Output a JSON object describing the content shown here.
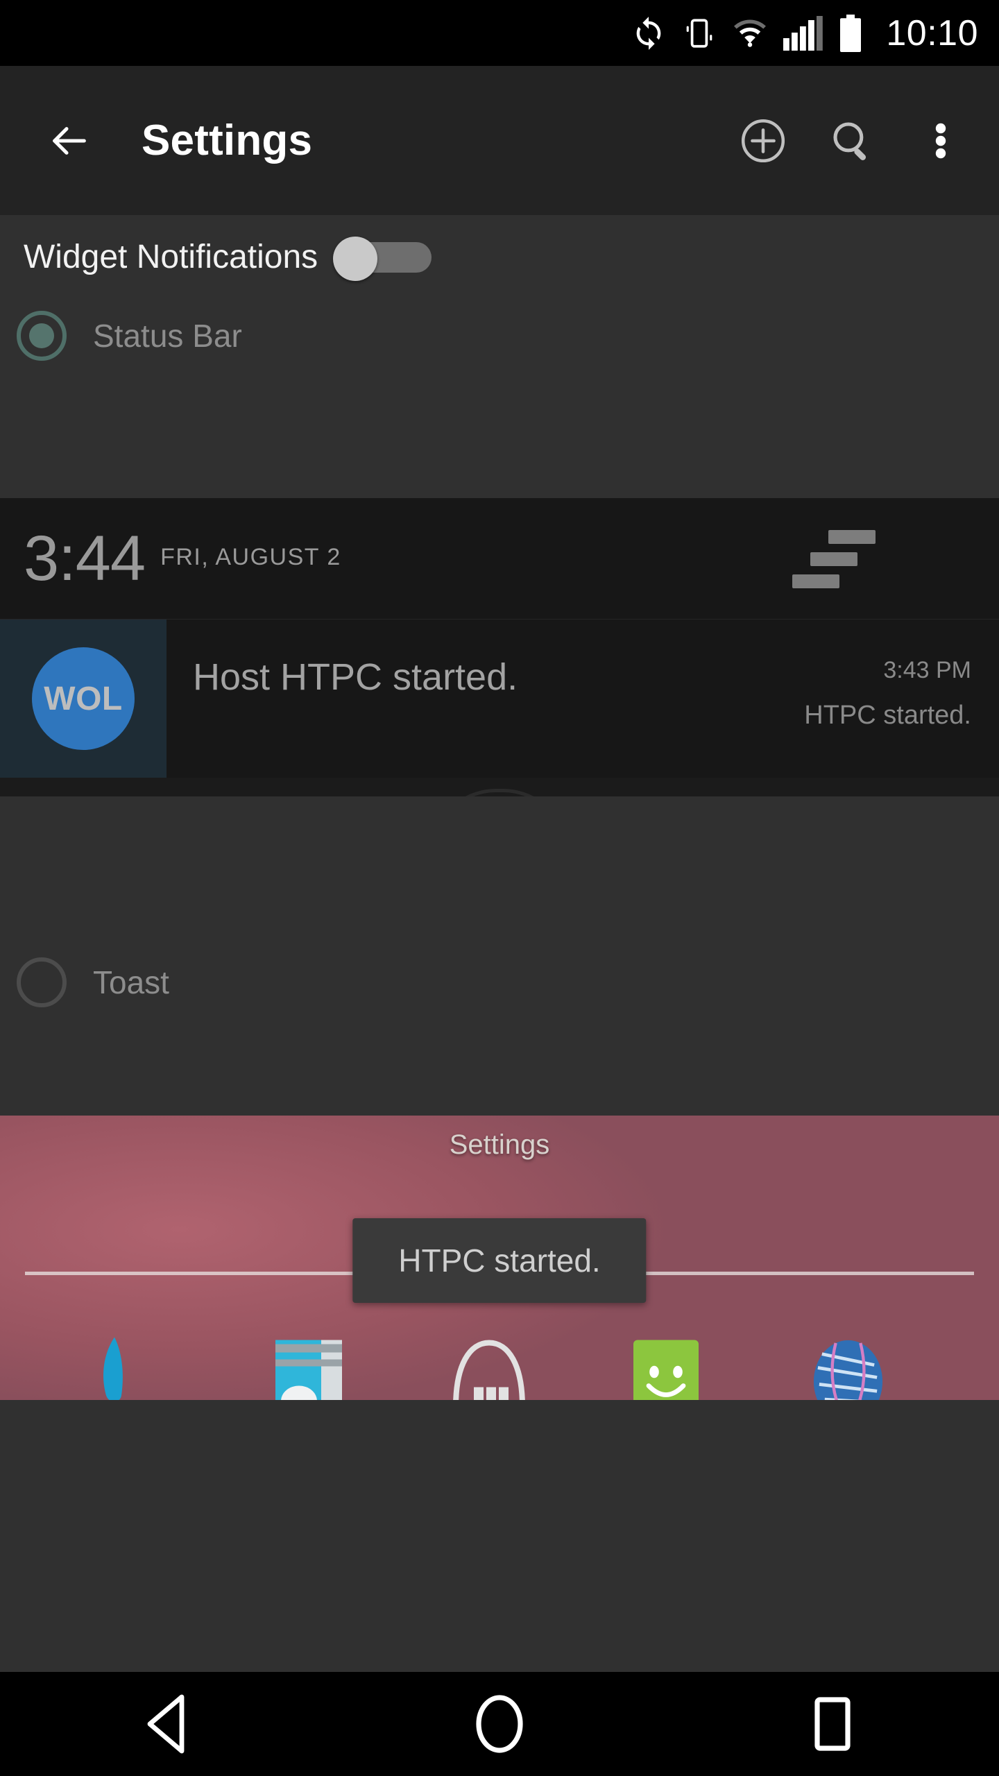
{
  "status_bar": {
    "time": "10:10",
    "icons": [
      "sync-icon",
      "vibrate-icon",
      "wifi-icon",
      "signal-icon",
      "battery-icon"
    ]
  },
  "action_bar": {
    "back_label": "back-arrow-icon",
    "title": "Settings",
    "actions": [
      "add-icon",
      "search-icon",
      "overflow-menu-icon"
    ]
  },
  "settings": {
    "widget_notifications": {
      "label": "Widget Notifications",
      "toggle_state": "off"
    },
    "options": [
      {
        "label": "Status Bar",
        "selected": true
      },
      {
        "label": "Toast",
        "selected": false
      }
    ]
  },
  "notification_preview": {
    "clock": "3:44",
    "date": "FRI, AUGUST 2",
    "quick_settings_icon": "quick-settings-icon",
    "notification": {
      "app_icon_text": "WOL",
      "title": "Host HTPC started.",
      "time": "3:43 PM",
      "subtitle": "HTPC started."
    }
  },
  "home_preview": {
    "page_label": "Settings",
    "toast_text": "HTPC started.",
    "dock_icons": [
      "phone-icon",
      "camera-icon",
      "app-drawer-icon",
      "messaging-icon",
      "browser-icon"
    ]
  },
  "nav_bar": {
    "buttons": [
      "back-nav-icon",
      "home-nav-icon",
      "recents-nav-icon"
    ]
  },
  "colors": {
    "status_bar_bg": "#000000",
    "action_bar_bg": "#232323",
    "body_bg": "#303030",
    "preview_bg": "#171717",
    "accent_radio": "#55746d",
    "wol_blue": "#2f76bd",
    "toast_bg": "#3a3a3a"
  }
}
